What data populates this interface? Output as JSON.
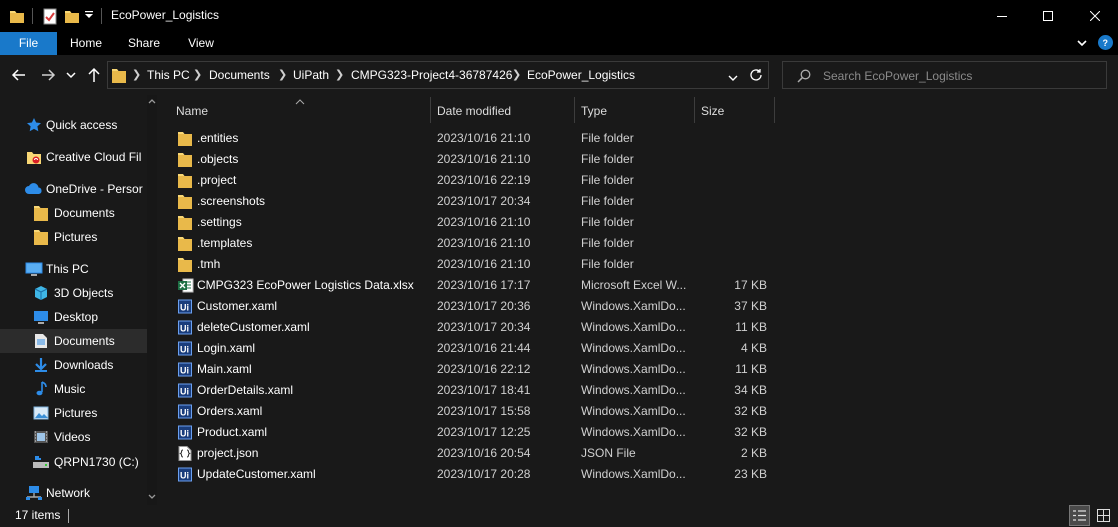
{
  "window": {
    "title": "EcoPower_Logistics",
    "controls": {
      "minimize": "minimize-icon",
      "maximize": "maximize-icon",
      "close": "close-icon"
    }
  },
  "ribbon": {
    "tabs": [
      {
        "label": "File"
      },
      {
        "label": "Home"
      },
      {
        "label": "Share"
      },
      {
        "label": "View"
      }
    ]
  },
  "address": {
    "crumbs": [
      "This PC",
      "Documents",
      "UiPath",
      "CMPG323-Project4-36787426",
      "EcoPower_Logistics"
    ]
  },
  "search": {
    "placeholder": "Search EcoPower_Logistics"
  },
  "sidebar": {
    "items": [
      {
        "label": "Quick access",
        "icon": "star-icon"
      },
      {
        "label": "Creative Cloud Fil",
        "icon": "creative-cloud-folder-icon"
      },
      {
        "label": "OneDrive - Persor",
        "icon": "cloud-icon"
      },
      {
        "label": "Documents",
        "icon": "folder-icon"
      },
      {
        "label": "Pictures",
        "icon": "folder-icon"
      },
      {
        "label": "This PC",
        "icon": "computer-icon"
      },
      {
        "label": "3D Objects",
        "icon": "cube-icon"
      },
      {
        "label": "Desktop",
        "icon": "desktop-icon"
      },
      {
        "label": "Documents",
        "icon": "document-icon"
      },
      {
        "label": "Downloads",
        "icon": "download-icon"
      },
      {
        "label": "Music",
        "icon": "music-icon"
      },
      {
        "label": "Pictures",
        "icon": "pictures-icon"
      },
      {
        "label": "Videos",
        "icon": "video-icon"
      },
      {
        "label": "QRPN1730 (C:)",
        "icon": "drive-icon"
      },
      {
        "label": "Network",
        "icon": "network-icon"
      }
    ]
  },
  "columns": {
    "name": "Name",
    "date": "Date modified",
    "type": "Type",
    "size": "Size"
  },
  "files": [
    {
      "name": ".entities",
      "date": "2023/10/16 21:10",
      "type": "File folder",
      "size": "",
      "icon": "folder-icon"
    },
    {
      "name": ".objects",
      "date": "2023/10/16 21:10",
      "type": "File folder",
      "size": "",
      "icon": "folder-icon"
    },
    {
      "name": ".project",
      "date": "2023/10/16 22:19",
      "type": "File folder",
      "size": "",
      "icon": "folder-icon"
    },
    {
      "name": ".screenshots",
      "date": "2023/10/17 20:34",
      "type": "File folder",
      "size": "",
      "icon": "folder-icon"
    },
    {
      "name": ".settings",
      "date": "2023/10/16 21:10",
      "type": "File folder",
      "size": "",
      "icon": "folder-icon"
    },
    {
      "name": ".templates",
      "date": "2023/10/16 21:10",
      "type": "File folder",
      "size": "",
      "icon": "folder-icon"
    },
    {
      "name": ".tmh",
      "date": "2023/10/16 21:10",
      "type": "File folder",
      "size": "",
      "icon": "folder-icon"
    },
    {
      "name": "CMPG323 EcoPower Logistics Data.xlsx",
      "date": "2023/10/16 17:17",
      "type": "Microsoft Excel W...",
      "size": "17 KB",
      "icon": "excel-icon"
    },
    {
      "name": "Customer.xaml",
      "date": "2023/10/17 20:36",
      "type": "Windows.XamlDo...",
      "size": "37 KB",
      "icon": "uipath-icon"
    },
    {
      "name": "deleteCustomer.xaml",
      "date": "2023/10/17 20:34",
      "type": "Windows.XamlDo...",
      "size": "11 KB",
      "icon": "uipath-icon"
    },
    {
      "name": "Login.xaml",
      "date": "2023/10/16 21:44",
      "type": "Windows.XamlDo...",
      "size": "4 KB",
      "icon": "uipath-icon"
    },
    {
      "name": "Main.xaml",
      "date": "2023/10/16 22:12",
      "type": "Windows.XamlDo...",
      "size": "11 KB",
      "icon": "uipath-icon"
    },
    {
      "name": "OrderDetails.xaml",
      "date": "2023/10/17 18:41",
      "type": "Windows.XamlDo...",
      "size": "34 KB",
      "icon": "uipath-icon"
    },
    {
      "name": "Orders.xaml",
      "date": "2023/10/17 15:58",
      "type": "Windows.XamlDo...",
      "size": "32 KB",
      "icon": "uipath-icon"
    },
    {
      "name": "Product.xaml",
      "date": "2023/10/17 12:25",
      "type": "Windows.XamlDo...",
      "size": "32 KB",
      "icon": "uipath-icon"
    },
    {
      "name": "project.json",
      "date": "2023/10/16 20:54",
      "type": "JSON File",
      "size": "2 KB",
      "icon": "json-icon"
    },
    {
      "name": "UpdateCustomer.xaml",
      "date": "2023/10/17 20:28",
      "type": "Windows.XamlDo...",
      "size": "23 KB",
      "icon": "uipath-icon"
    }
  ],
  "status": {
    "item_count": "17 items"
  },
  "colors": {
    "accent": "#1979ca",
    "folder": "#f8d775",
    "background": "#191919",
    "titlebar": "#000000"
  }
}
